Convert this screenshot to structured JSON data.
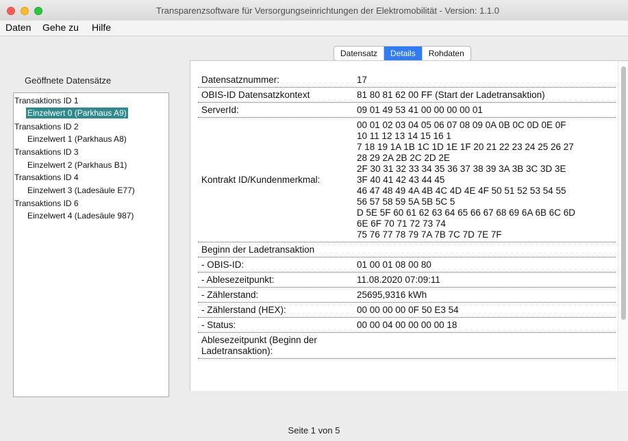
{
  "window": {
    "title": "Transparenzsoftware für Versorgungseinrichtungen der Elektromobilität - Version: 1.1.0"
  },
  "menu": [
    "Daten",
    "Gehe zu",
    "Hilfe"
  ],
  "left_panel": {
    "title": "Geöffnete Datensätze",
    "tree": [
      {
        "label": "Transaktions ID 1",
        "level": 0,
        "selected": false
      },
      {
        "label": "Einzelwert 0 (Parkhaus A9)",
        "level": 1,
        "selected": true
      },
      {
        "label": "Transaktions ID 2",
        "level": 0,
        "selected": false
      },
      {
        "label": "Einzelwert 1 (Parkhaus A8)",
        "level": 1,
        "selected": false
      },
      {
        "label": "Transaktions ID 3",
        "level": 0,
        "selected": false
      },
      {
        "label": "Einzelwert 2 (Parkhaus B1)",
        "level": 1,
        "selected": false
      },
      {
        "label": "Transaktions ID 4",
        "level": 0,
        "selected": false
      },
      {
        "label": "Einzelwert 3 (Ladesäule E77)",
        "level": 1,
        "selected": false
      },
      {
        "label": "Transaktions ID 6",
        "level": 0,
        "selected": false
      },
      {
        "label": "Einzelwert 4 (Ladesäule 987)",
        "level": 1,
        "selected": false
      }
    ]
  },
  "tabs": [
    {
      "label": "Datensatz",
      "active": false
    },
    {
      "label": "Details",
      "active": true
    },
    {
      "label": "Rohdaten",
      "active": false
    }
  ],
  "details": [
    {
      "label": "Datensatznummer:",
      "value": "17"
    },
    {
      "label": "OBIS-ID Datensatzkontext",
      "value": "81 80 81 62 00 FF (Start der Ladetransaktion)"
    },
    {
      "label": "ServerId:",
      "value": "09 01 49 53 41 00 00 00 00 01"
    },
    {
      "label": "Kontrakt ID/Kundenmerkmal:",
      "value": "00 01 02 03 04 05 06 07 08 09 0A 0B 0C 0D 0E 0F\n10 11 12 13 14 15 16 1\n7 18 19 1A 1B 1C 1D 1E 1F 20 21 22 23 24 25 26 27\n28 29 2A 2B 2C 2D 2E\n2F 30 31 32 33 34 35 36 37 38 39 3A 3B 3C 3D 3E\n3F 40 41 42 43 44 45\n46 47 48 49 4A 4B 4C 4D 4E 4F 50 51 52 53 54 55\n56 57 58 59 5A 5B 5C 5\nD 5E 5F 60 61 62 63 64 65 66 67 68 69 6A 6B 6C 6D\n6E 6F 70 71 72 73 74\n75 76 77 78 79 7A 7B 7C 7D 7E 7F"
    },
    {
      "label": "Beginn der Ladetransaktion",
      "value": ""
    },
    {
      "label": "- OBIS-ID:",
      "value": "01 00 01 08 00 80"
    },
    {
      "label": "- Ablesezeitpunkt:",
      "value": "11.08.2020 07:09:11"
    },
    {
      "label": "- Zählerstand:",
      "value": "25695,9316 kWh"
    },
    {
      "label": "- Zählerstand (HEX):",
      "value": "00 00 00 00 0F 50 E3 54"
    },
    {
      "label": "- Status:",
      "value": "00 00 04 00 00 00 00 18"
    },
    {
      "label": "Ablesezeitpunkt (Beginn der\nLadetransaktion):",
      "value": ""
    }
  ],
  "footer": {
    "pager": "Seite 1 von 5"
  }
}
